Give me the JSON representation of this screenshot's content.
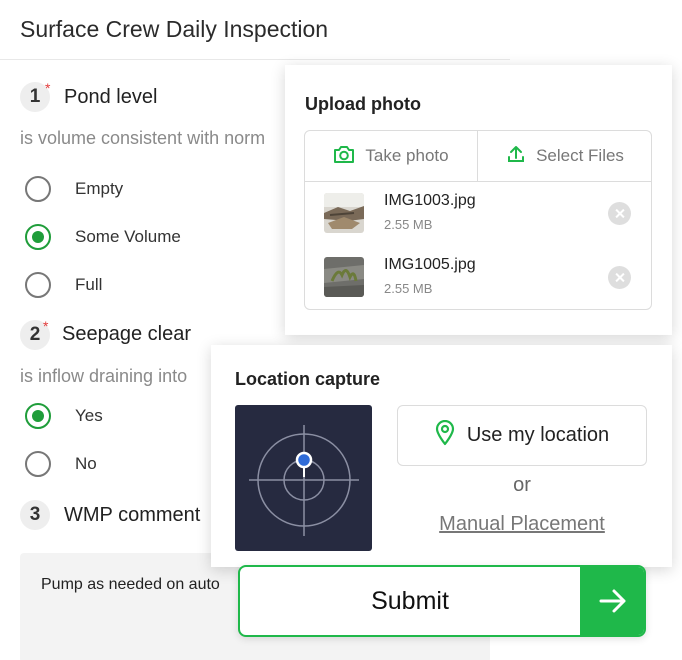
{
  "app_title": "Surface Crew Daily Inspection",
  "questions": [
    {
      "number": "1",
      "required_mark": "*",
      "title": "Pond level",
      "description": "is volume consistent with norm",
      "options": [
        {
          "label": "Empty",
          "selected": false
        },
        {
          "label": "Some Volume",
          "selected": true
        },
        {
          "label": "Full",
          "selected": false
        }
      ]
    },
    {
      "number": "2",
      "required_mark": "*",
      "title": "Seepage clear",
      "description": "is inflow draining into",
      "options": [
        {
          "label": "Yes",
          "selected": true
        },
        {
          "label": "No",
          "selected": false
        }
      ]
    },
    {
      "number": "3",
      "title": "WMP comment",
      "value": "Pump as needed on auto"
    }
  ],
  "upload": {
    "title": "Upload photo",
    "take_photo_label": "Take photo",
    "select_files_label": "Select Files",
    "files": [
      {
        "name": "IMG1003.jpg",
        "size": "2.55 MB"
      },
      {
        "name": "IMG1005.jpg",
        "size": "2.55 MB"
      }
    ]
  },
  "location": {
    "title": "Location capture",
    "use_location_label": "Use my location",
    "or_label": "or",
    "manual_label": "Manual Placement"
  },
  "submit_label": "Submit",
  "colors": {
    "accent": "#1fb84a",
    "selected": "#1f9d3a",
    "required": "#e23b3b",
    "map_bg": "#262a40"
  }
}
